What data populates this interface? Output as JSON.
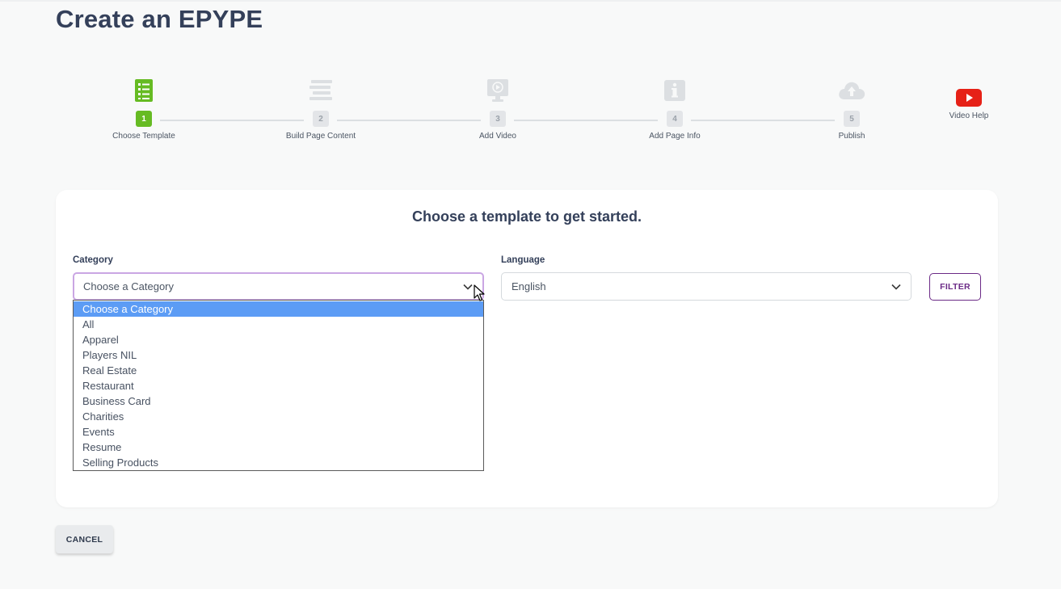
{
  "page": {
    "title": "Create an EPYPE"
  },
  "stepper": {
    "steps": [
      {
        "number": "1",
        "label": "Choose Template",
        "icon": "checklist-icon",
        "active": true
      },
      {
        "number": "2",
        "label": "Build Page Content",
        "icon": "text-lines-icon",
        "active": false
      },
      {
        "number": "3",
        "label": "Add Video",
        "icon": "video-monitor-icon",
        "active": false
      },
      {
        "number": "4",
        "label": "Add Page Info",
        "icon": "info-icon",
        "active": false
      },
      {
        "number": "5",
        "label": "Publish",
        "icon": "cloud-upload-icon",
        "active": false
      }
    ],
    "video_help": {
      "label": "Video Help",
      "icon": "youtube-icon"
    },
    "active_color": "#66bb23",
    "inactive_color": "#dcdfe2"
  },
  "card": {
    "title": "Choose a template to get started.",
    "category": {
      "label": "Category",
      "value": "Choose a Category",
      "options": [
        "Choose a Category",
        "All",
        "Apparel",
        "Players NIL",
        "Real Estate",
        "Restaurant",
        "Business Card",
        "Charities",
        "Events",
        "Resume",
        "Selling Products"
      ],
      "selected_index": 0
    },
    "language": {
      "label": "Language",
      "value": "English"
    },
    "filter_label": "FILTER"
  },
  "actions": {
    "cancel_label": "CANCEL"
  },
  "colors": {
    "accent_purple": "#6b2a86",
    "focus_ring": "#caa6e3",
    "highlight_blue": "#5c9cf5",
    "youtube_red": "#e62117"
  }
}
